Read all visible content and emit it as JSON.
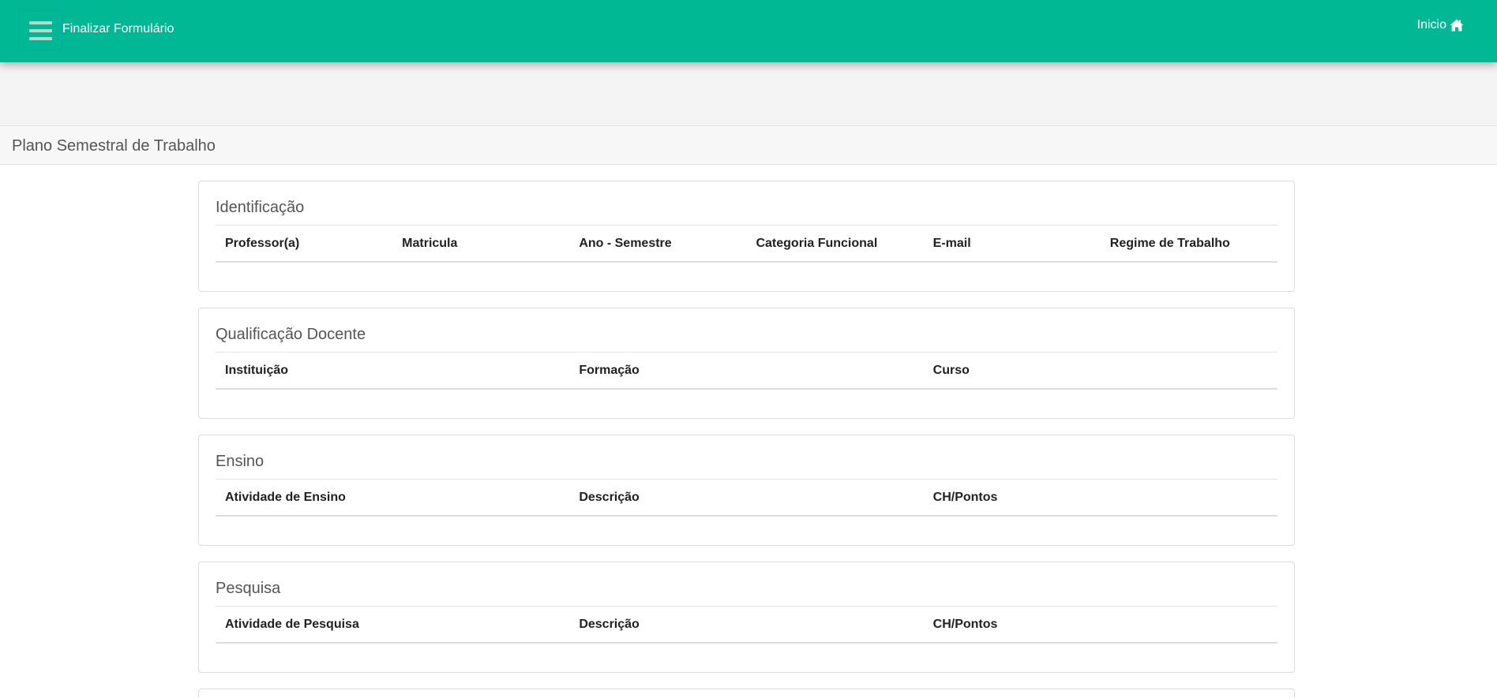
{
  "navbar": {
    "menu_icon": "hamburger-menu-icon",
    "title": "Finalizar Formulário",
    "home_label": "Inicio",
    "home_icon": "home-icon",
    "background": "#00b894"
  },
  "page": {
    "title": "Plano Semestral de Trabalho"
  },
  "panels": [
    {
      "title": "Identificação",
      "columns": [
        "Professor(a)",
        "Matricula",
        "Ano - Semestre",
        "Categoria Funcional",
        "E-mail",
        "Regime de Trabalho"
      ]
    },
    {
      "title": "Qualificação Docente",
      "columns": [
        "Instituição",
        "Formação",
        "Curso"
      ]
    },
    {
      "title": "Ensino",
      "columns": [
        "Atividade de Ensino",
        "Descrição",
        "CH/Pontos"
      ]
    },
    {
      "title": "Pesquisa",
      "columns": [
        "Atividade de Pesquisa",
        "Descrição",
        "CH/Pontos"
      ]
    }
  ]
}
